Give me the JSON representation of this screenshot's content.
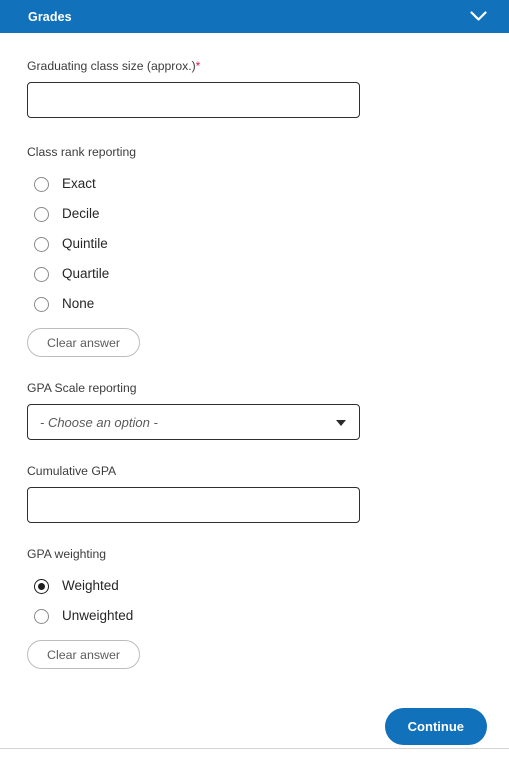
{
  "header": {
    "title": "Grades",
    "collapse_icon": "chevron-down-icon",
    "accent_color": "#1271bb"
  },
  "fields": {
    "class_size": {
      "label": "Graduating class size (approx.)",
      "required_marker": "*",
      "value": "",
      "placeholder": ""
    },
    "class_rank": {
      "label": "Class rank reporting",
      "options": [
        {
          "label": "Exact",
          "selected": false
        },
        {
          "label": "Decile",
          "selected": false
        },
        {
          "label": "Quintile",
          "selected": false
        },
        {
          "label": "Quartile",
          "selected": false
        },
        {
          "label": "None",
          "selected": false
        }
      ],
      "clear_label": "Clear answer"
    },
    "gpa_scale": {
      "label": "GPA Scale reporting",
      "selected_value": "- Choose an option -",
      "dropdown_icon": "chevron-down-icon"
    },
    "cumulative_gpa": {
      "label": "Cumulative GPA",
      "value": "",
      "placeholder": ""
    },
    "gpa_weighting": {
      "label": "GPA weighting",
      "options": [
        {
          "label": "Weighted",
          "selected": true
        },
        {
          "label": "Unweighted",
          "selected": false
        }
      ],
      "clear_label": "Clear answer"
    }
  },
  "footer": {
    "continue_label": "Continue"
  }
}
